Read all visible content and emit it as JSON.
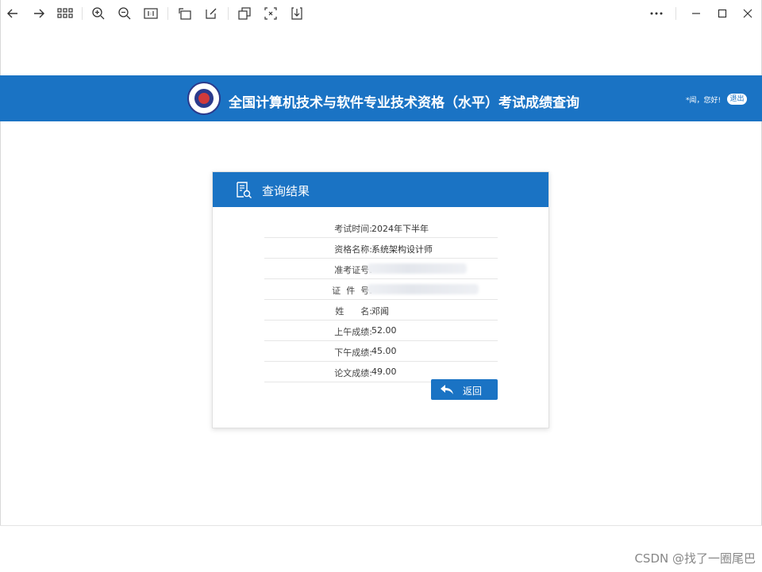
{
  "banner": {
    "title": "全国计算机技术与软件专业技术资格（水平）考试成绩查询",
    "greeting": "*闻，您好!",
    "logout_label": "退出"
  },
  "card": {
    "title": "查询结果",
    "rows": [
      {
        "label": "考试时间:",
        "value": "2024年下半年"
      },
      {
        "label": "资格名称:",
        "value": "系统架构设计师"
      },
      {
        "label": "准考证号:",
        "value": ""
      },
      {
        "label": "证  件  号:",
        "value": ""
      },
      {
        "label": "姓      名:",
        "value": "邓闻"
      },
      {
        "label": "上午成绩:",
        "value": "52.00"
      },
      {
        "label": "下午成绩:",
        "value": "45.00"
      },
      {
        "label": "论文成绩:",
        "value": "49.00"
      }
    ],
    "back_label": "返回"
  },
  "watermark": "CSDN @找了一圈尾巴",
  "toolbar": {
    "icons": [
      "back-arrow-icon",
      "forward-arrow-icon",
      "grid-icon",
      "zoom-in-icon",
      "zoom-out-icon",
      "actual-size-icon",
      "rotate-icon",
      "edit-icon",
      "copy-icon",
      "crop-icon",
      "download-icon",
      "more-icon",
      "minimize-icon",
      "maximize-icon",
      "close-icon"
    ]
  },
  "colors": {
    "brand": "#1a73c4"
  }
}
